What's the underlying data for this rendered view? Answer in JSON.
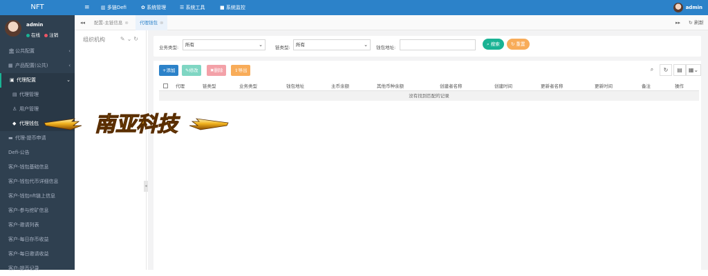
{
  "app": {
    "title": "NFT"
  },
  "user": {
    "name": "admin",
    "status_online": "在线",
    "status_logout": "注销"
  },
  "topnav": {
    "menu_icon": "menu-icon",
    "items": [
      "多链Defi",
      "系统管理",
      "系统工具",
      "系统监控"
    ],
    "user": "admin"
  },
  "sidebar": {
    "items": [
      {
        "label": "公共配置",
        "icon": "bank-icon",
        "arrow": "‹"
      },
      {
        "label": "产品配置(公共)",
        "icon": "chart-icon",
        "arrow": "‹"
      },
      {
        "label": "代理配置",
        "icon": "window-icon",
        "arrow": "⌄"
      }
    ],
    "sub_items": [
      "代理管理",
      "用户管理",
      "代理钱包"
    ],
    "items_after": [
      "代理-提币申请",
      "Defi-公告",
      "客户-钱包基础信息",
      "客户-钱包代币详细信息",
      "客户-钱包nft链上信息",
      "客户-参与挖矿信息",
      "客户-邀请列表",
      "客户-每日存币收益",
      "客户-每日邀请收益",
      "客户-提币记录"
    ]
  },
  "watermark": {
    "text": "南亚科技"
  },
  "tabs": {
    "prev": "◂◂",
    "next": "▸▸",
    "refresh": "刷新",
    "items": [
      {
        "label": "配置-主链信息",
        "active": false
      },
      {
        "label": "代理钱包",
        "active": true
      }
    ]
  },
  "org_panel": {
    "title": "组织机构",
    "tools": "✎⌄↻"
  },
  "search": {
    "business_type_label": "业务类型:",
    "business_type_value": "所有",
    "chain_type_label": "链类型:",
    "chain_type_value": "所有",
    "wallet_address_label": "钱包地址:",
    "wallet_address_value": "",
    "search_button": "搜索",
    "reset_button": "重置"
  },
  "toolbar": {
    "add": "添加",
    "edit": "修改",
    "delete": "删除",
    "export": "导出"
  },
  "table": {
    "columns": [
      "代理",
      "链类型",
      "业务类型",
      "钱包地址",
      "主币余额",
      "其他币种余额",
      "创建者名称",
      "创建时间",
      "更新者名称",
      "更新时间",
      "备注",
      "操作"
    ],
    "empty_text": "没有找到匹配的记录"
  },
  "colors": {
    "primary": "#2c82c9",
    "sidebar_bg": "#2f4050",
    "accent_green": "#1ab394",
    "btn_add": "#2c82c9",
    "btn_edit": "#7fd6c3",
    "btn_delete": "#f3a1a8",
    "btn_export": "#f8ac59",
    "status_online": "#1ab394",
    "status_logout": "#ed5565"
  }
}
